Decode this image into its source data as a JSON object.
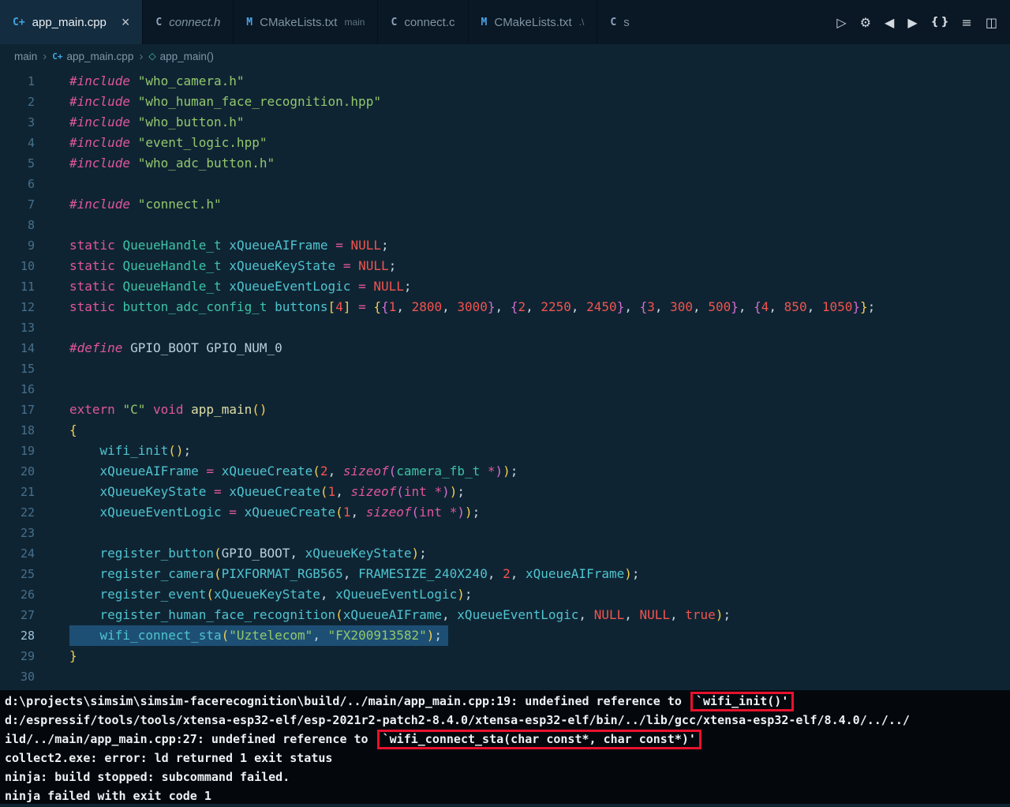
{
  "colors": {
    "editor_bg": "#0f2433",
    "tabbar_bg": "#0a1724",
    "terminal_bg": "#04080d",
    "selection": "#1d4f74",
    "error_box_border": "#e8112d",
    "keyword_pink": "#e0569e",
    "string_green": "#93c86c",
    "number_red": "#f2544e",
    "identifier_teal": "#4fc4cf"
  },
  "icons": {
    "cpp": "C+",
    "c": "C",
    "cmake": "M",
    "symbol": "◇",
    "close": "×"
  },
  "tab_bar": {
    "tabs": [
      {
        "label": "app_main.cpp",
        "icon": "cpp",
        "state": "active",
        "closable": true
      },
      {
        "label": "connect.h",
        "icon": "c",
        "state": "preview"
      },
      {
        "label": "CMakeLists.txt",
        "suffix": "main",
        "icon": "cmake"
      },
      {
        "label": "connect.c",
        "icon": "c"
      },
      {
        "label": "CMakeLists.txt",
        "suffix": ".\\",
        "icon": "cmake"
      },
      {
        "label": "s",
        "icon": "c",
        "partial": true
      }
    ],
    "actions": [
      {
        "name": "run-or-debug-button",
        "glyph": "▷"
      },
      {
        "name": "settings-gear-button",
        "glyph": "⚙"
      },
      {
        "name": "navigate-back-button",
        "glyph": "◀"
      },
      {
        "name": "navigate-forward-button",
        "glyph": "▶"
      },
      {
        "name": "braces-button",
        "glyph": "{ }",
        "cls": "braces"
      },
      {
        "name": "outline-list-button",
        "glyph": "≡"
      },
      {
        "name": "split-editor-button",
        "glyph": "◫"
      }
    ]
  },
  "breadcrumb": {
    "items": [
      {
        "label": "main"
      },
      {
        "label": "app_main.cpp",
        "icon": "cpp"
      },
      {
        "label": "app_main()",
        "icon": "symbol"
      }
    ],
    "separator": "›"
  },
  "editor": {
    "active_line": 28,
    "lines": [
      [
        [
          "kwi",
          "#include"
        ],
        [
          "pln",
          " "
        ],
        [
          "str",
          "\"who_camera.h\""
        ]
      ],
      [
        [
          "kwi",
          "#include"
        ],
        [
          "pln",
          " "
        ],
        [
          "str",
          "\"who_human_face_recognition.hpp\""
        ]
      ],
      [
        [
          "kwi",
          "#include"
        ],
        [
          "pln",
          " "
        ],
        [
          "str",
          "\"who_button.h\""
        ]
      ],
      [
        [
          "kwi",
          "#include"
        ],
        [
          "pln",
          " "
        ],
        [
          "str",
          "\"event_logic.hpp\""
        ]
      ],
      [
        [
          "kwi",
          "#include"
        ],
        [
          "pln",
          " "
        ],
        [
          "str",
          "\"who_adc_button.h\""
        ]
      ],
      [],
      [
        [
          "kwi",
          "#include"
        ],
        [
          "pln",
          " "
        ],
        [
          "str",
          "\"connect.h\""
        ]
      ],
      [],
      [
        [
          "kw",
          "static"
        ],
        [
          "pln",
          " "
        ],
        [
          "typ",
          "QueueHandle_t"
        ],
        [
          "pln",
          " "
        ],
        [
          "id",
          "xQueueAIFrame"
        ],
        [
          "pln",
          " "
        ],
        [
          "op",
          "="
        ],
        [
          "pln",
          " "
        ],
        [
          "cst",
          "NULL"
        ],
        [
          "pln",
          ";"
        ]
      ],
      [
        [
          "kw",
          "static"
        ],
        [
          "pln",
          " "
        ],
        [
          "typ",
          "QueueHandle_t"
        ],
        [
          "pln",
          " "
        ],
        [
          "id",
          "xQueueKeyState"
        ],
        [
          "pln",
          " "
        ],
        [
          "op",
          "="
        ],
        [
          "pln",
          " "
        ],
        [
          "cst",
          "NULL"
        ],
        [
          "pln",
          ";"
        ]
      ],
      [
        [
          "kw",
          "static"
        ],
        [
          "pln",
          " "
        ],
        [
          "typ",
          "QueueHandle_t"
        ],
        [
          "pln",
          " "
        ],
        [
          "id",
          "xQueueEventLogic"
        ],
        [
          "pln",
          " "
        ],
        [
          "op",
          "="
        ],
        [
          "pln",
          " "
        ],
        [
          "cst",
          "NULL"
        ],
        [
          "pln",
          ";"
        ]
      ],
      [
        [
          "kw",
          "static"
        ],
        [
          "pln",
          " "
        ],
        [
          "typ",
          "button_adc_config_t"
        ],
        [
          "pln",
          " "
        ],
        [
          "id",
          "buttons"
        ],
        [
          "br0",
          "["
        ],
        [
          "num",
          "4"
        ],
        [
          "br0",
          "]"
        ],
        [
          "pln",
          " "
        ],
        [
          "op",
          "="
        ],
        [
          "pln",
          " "
        ],
        [
          "br0",
          "{"
        ],
        [
          "br1",
          "{"
        ],
        [
          "num",
          "1"
        ],
        [
          "pln",
          ", "
        ],
        [
          "num",
          "2800"
        ],
        [
          "pln",
          ", "
        ],
        [
          "num",
          "3000"
        ],
        [
          "br1",
          "}"
        ],
        [
          "pln",
          ", "
        ],
        [
          "br1",
          "{"
        ],
        [
          "num",
          "2"
        ],
        [
          "pln",
          ", "
        ],
        [
          "num",
          "2250"
        ],
        [
          "pln",
          ", "
        ],
        [
          "num",
          "2450"
        ],
        [
          "br1",
          "}"
        ],
        [
          "pln",
          ", "
        ],
        [
          "br1",
          "{"
        ],
        [
          "num",
          "3"
        ],
        [
          "pln",
          ", "
        ],
        [
          "num",
          "300"
        ],
        [
          "pln",
          ", "
        ],
        [
          "num",
          "500"
        ],
        [
          "br1",
          "}"
        ],
        [
          "pln",
          ", "
        ],
        [
          "br1",
          "{"
        ],
        [
          "num",
          "4"
        ],
        [
          "pln",
          ", "
        ],
        [
          "num",
          "850"
        ],
        [
          "pln",
          ", "
        ],
        [
          "num",
          "1050"
        ],
        [
          "br1",
          "}"
        ],
        [
          "br0",
          "}"
        ],
        [
          "pln",
          ";"
        ]
      ],
      [],
      [
        [
          "kwi",
          "#define"
        ],
        [
          "pln",
          " "
        ],
        [
          "mac",
          "GPIO_BOOT"
        ],
        [
          "pln",
          " "
        ],
        [
          "mac",
          "GPIO_NUM_0"
        ]
      ],
      [],
      [],
      [
        [
          "kw",
          "extern"
        ],
        [
          "pln",
          " "
        ],
        [
          "str",
          "\"C\""
        ],
        [
          "pln",
          " "
        ],
        [
          "kw",
          "void"
        ],
        [
          "pln",
          " "
        ],
        [
          "fnd",
          "app_main"
        ],
        [
          "br0",
          "("
        ],
        [
          "br0",
          ")"
        ]
      ],
      [
        [
          "br0",
          "{"
        ]
      ],
      [
        [
          "pln",
          "    "
        ],
        [
          "id",
          "wifi_init"
        ],
        [
          "br0",
          "("
        ],
        [
          "br0",
          ")"
        ],
        [
          "pln",
          ";"
        ]
      ],
      [
        [
          "pln",
          "    "
        ],
        [
          "id",
          "xQueueAIFrame"
        ],
        [
          "pln",
          " "
        ],
        [
          "op",
          "="
        ],
        [
          "pln",
          " "
        ],
        [
          "id",
          "xQueueCreate"
        ],
        [
          "br0",
          "("
        ],
        [
          "num",
          "2"
        ],
        [
          "pln",
          ", "
        ],
        [
          "kwi",
          "sizeof"
        ],
        [
          "br1",
          "("
        ],
        [
          "typ",
          "camera_fb_t"
        ],
        [
          "pln",
          " "
        ],
        [
          "op",
          "*"
        ],
        [
          "br1",
          ")"
        ],
        [
          "br0",
          ")"
        ],
        [
          "pln",
          ";"
        ]
      ],
      [
        [
          "pln",
          "    "
        ],
        [
          "id",
          "xQueueKeyState"
        ],
        [
          "pln",
          " "
        ],
        [
          "op",
          "="
        ],
        [
          "pln",
          " "
        ],
        [
          "id",
          "xQueueCreate"
        ],
        [
          "br0",
          "("
        ],
        [
          "num",
          "1"
        ],
        [
          "pln",
          ", "
        ],
        [
          "kwi",
          "sizeof"
        ],
        [
          "br1",
          "("
        ],
        [
          "kw",
          "int"
        ],
        [
          "pln",
          " "
        ],
        [
          "op",
          "*"
        ],
        [
          "br1",
          ")"
        ],
        [
          "br0",
          ")"
        ],
        [
          "pln",
          ";"
        ]
      ],
      [
        [
          "pln",
          "    "
        ],
        [
          "id",
          "xQueueEventLogic"
        ],
        [
          "pln",
          " "
        ],
        [
          "op",
          "="
        ],
        [
          "pln",
          " "
        ],
        [
          "id",
          "xQueueCreate"
        ],
        [
          "br0",
          "("
        ],
        [
          "num",
          "1"
        ],
        [
          "pln",
          ", "
        ],
        [
          "kwi",
          "sizeof"
        ],
        [
          "br1",
          "("
        ],
        [
          "kw",
          "int"
        ],
        [
          "pln",
          " "
        ],
        [
          "op",
          "*"
        ],
        [
          "br1",
          ")"
        ],
        [
          "br0",
          ")"
        ],
        [
          "pln",
          ";"
        ]
      ],
      [],
      [
        [
          "pln",
          "    "
        ],
        [
          "id",
          "register_button"
        ],
        [
          "br0",
          "("
        ],
        [
          "mac",
          "GPIO_BOOT"
        ],
        [
          "pln",
          ", "
        ],
        [
          "id",
          "xQueueKeyState"
        ],
        [
          "br0",
          ")"
        ],
        [
          "pln",
          ";"
        ]
      ],
      [
        [
          "pln",
          "    "
        ],
        [
          "id",
          "register_camera"
        ],
        [
          "br0",
          "("
        ],
        [
          "id",
          "PIXFORMAT_RGB565"
        ],
        [
          "pln",
          ", "
        ],
        [
          "id",
          "FRAMESIZE_240X240"
        ],
        [
          "pln",
          ", "
        ],
        [
          "num",
          "2"
        ],
        [
          "pln",
          ", "
        ],
        [
          "id",
          "xQueueAIFrame"
        ],
        [
          "br0",
          ")"
        ],
        [
          "pln",
          ";"
        ]
      ],
      [
        [
          "pln",
          "    "
        ],
        [
          "id",
          "register_event"
        ],
        [
          "br0",
          "("
        ],
        [
          "id",
          "xQueueKeyState"
        ],
        [
          "pln",
          ", "
        ],
        [
          "id",
          "xQueueEventLogic"
        ],
        [
          "br0",
          ")"
        ],
        [
          "pln",
          ";"
        ]
      ],
      [
        [
          "pln",
          "    "
        ],
        [
          "id",
          "register_human_face_recognition"
        ],
        [
          "br0",
          "("
        ],
        [
          "id",
          "xQueueAIFrame"
        ],
        [
          "pln",
          ", "
        ],
        [
          "id",
          "xQueueEventLogic"
        ],
        [
          "pln",
          ", "
        ],
        [
          "cst",
          "NULL"
        ],
        [
          "pln",
          ", "
        ],
        [
          "cst",
          "NULL"
        ],
        [
          "pln",
          ", "
        ],
        [
          "cst",
          "true"
        ],
        [
          "br0",
          ")"
        ],
        [
          "pln",
          ";"
        ]
      ],
      [
        [
          "pln",
          "    "
        ],
        [
          "id",
          "wifi_connect_sta"
        ],
        [
          "br0",
          "("
        ],
        [
          "str",
          "\"Uztelecom\""
        ],
        [
          "pln",
          ", "
        ],
        [
          "str",
          "\"FX200913582\""
        ],
        [
          "br0",
          ")"
        ],
        [
          "pln",
          ";"
        ]
      ],
      [
        [
          "br0",
          "}"
        ]
      ],
      []
    ]
  },
  "terminal": {
    "lines": [
      [
        [
          "t",
          "d:\\projects\\simsim\\simsim-facerecognition\\build/../main/app_main.cpp:19: undefined reference to "
        ],
        [
          "box",
          "`wifi_init()'"
        ]
      ],
      [
        [
          "t",
          "d:/espressif/tools/tools/xtensa-esp32-elf/esp-2021r2-patch2-8.4.0/xtensa-esp32-elf/bin/../lib/gcc/xtensa-esp32-elf/8.4.0/../../"
        ]
      ],
      [
        [
          "t",
          "ild/../main/app_main.cpp:27: undefined reference to "
        ],
        [
          "box",
          "`wifi_connect_sta(char const*, char const*)'"
        ]
      ],
      [
        [
          "t",
          "collect2.exe: error: ld returned 1 exit status"
        ]
      ],
      [
        [
          "t",
          "ninja: build stopped: subcommand failed."
        ]
      ],
      [
        [
          "t",
          "ninja failed with exit code 1"
        ]
      ]
    ]
  }
}
